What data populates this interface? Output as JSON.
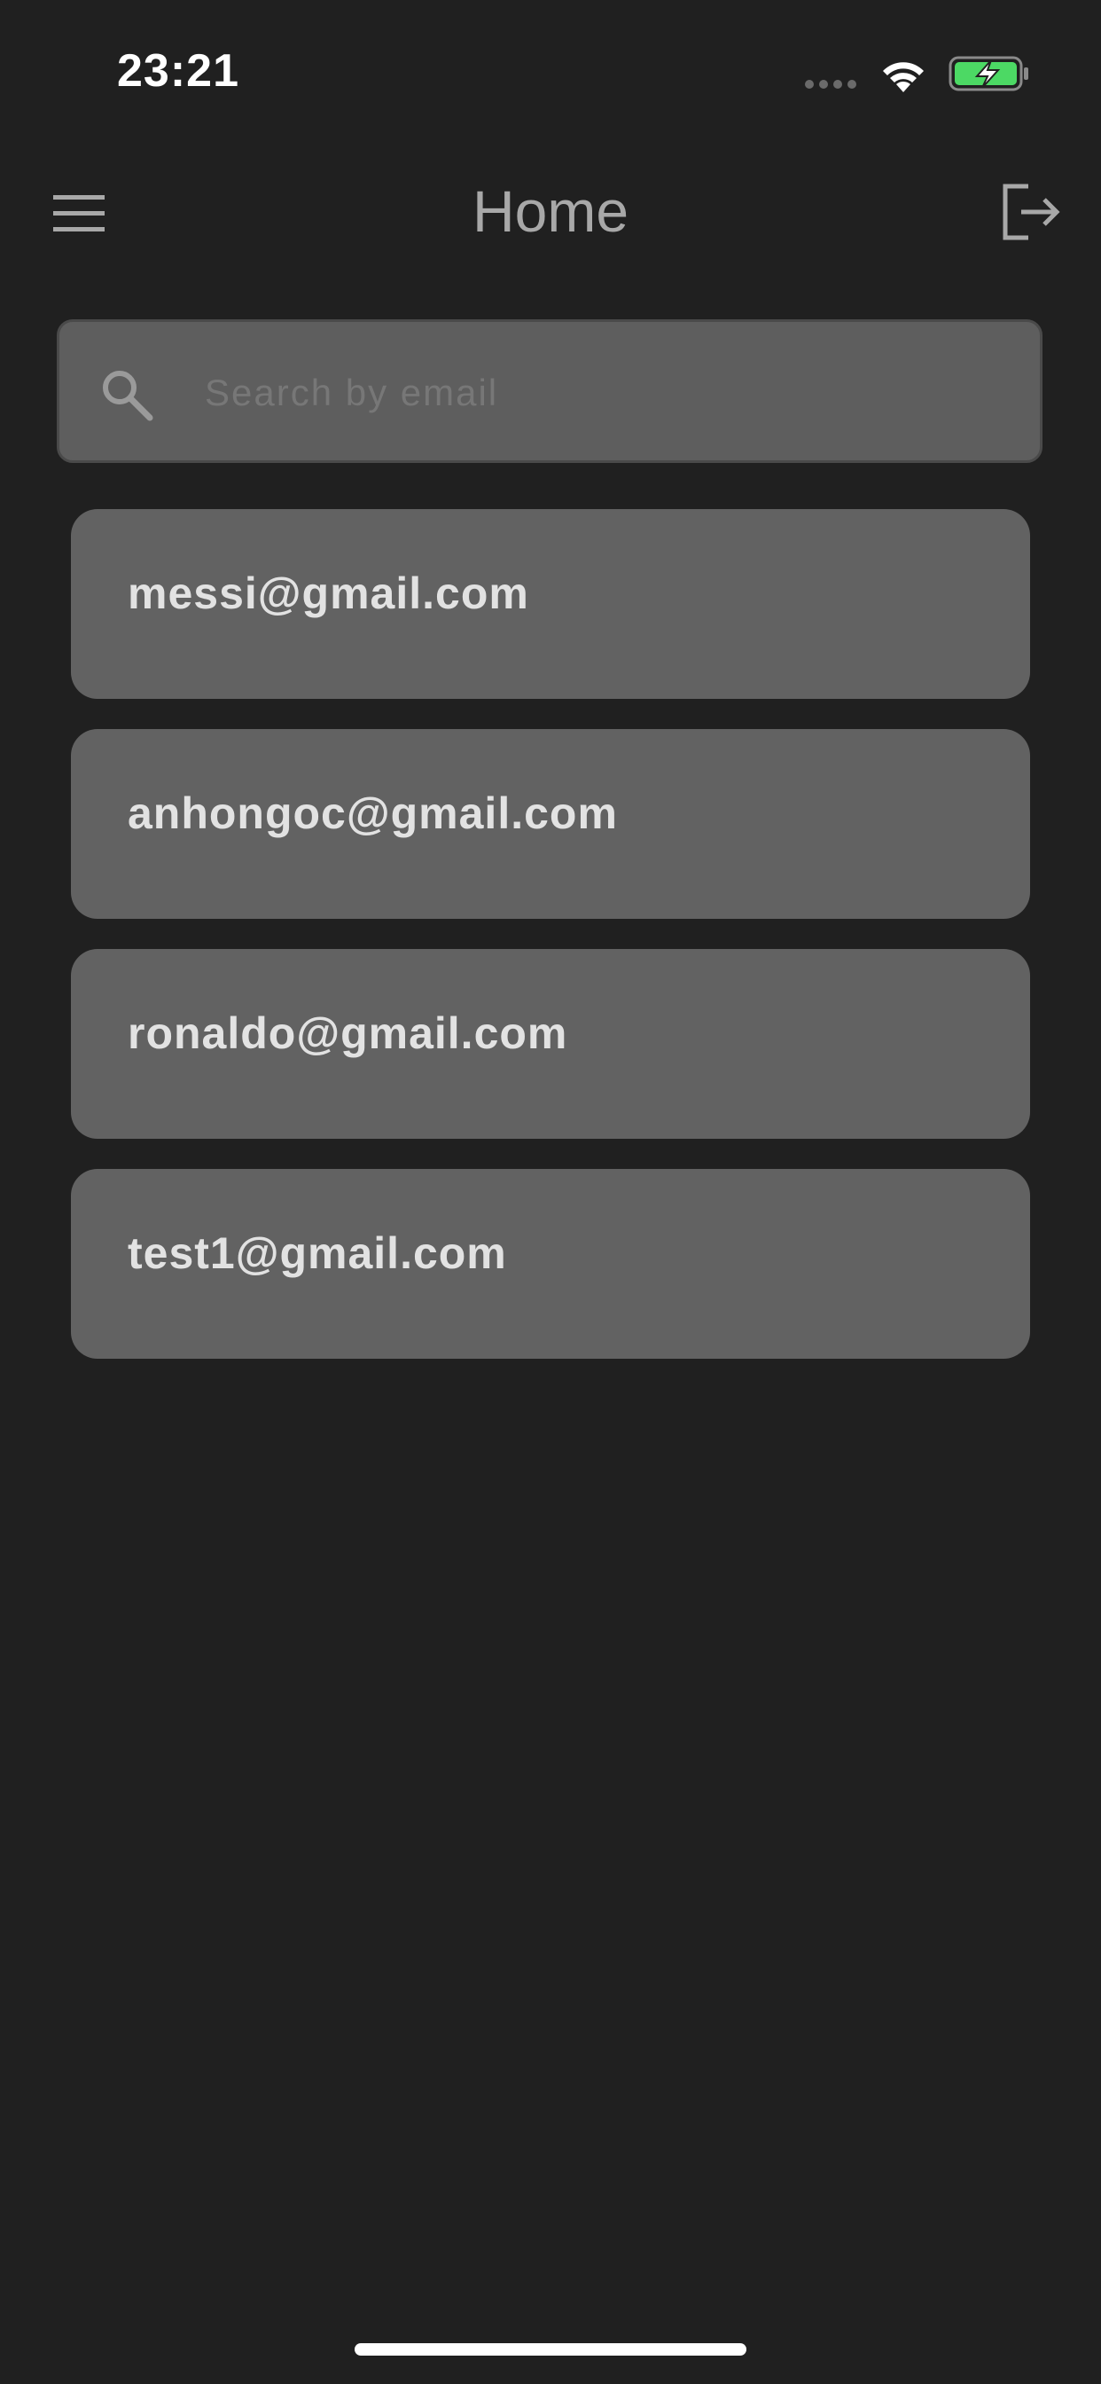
{
  "status_bar": {
    "time": "23:21",
    "icons": [
      "signal-dots-icon",
      "wifi-icon",
      "battery-charging-icon"
    ],
    "battery_color": "#4cd964"
  },
  "header": {
    "title": "Home",
    "left_icon": "menu-icon",
    "right_icon": "logout-icon"
  },
  "search": {
    "placeholder": "Search by email",
    "value": "",
    "icon": "search-icon"
  },
  "emails": [
    {
      "email": "messi@gmail.com"
    },
    {
      "email": "anhongoc@gmail.com"
    },
    {
      "email": "ronaldo@gmail.com"
    },
    {
      "email": "test1@gmail.com"
    }
  ],
  "colors": {
    "background": "#202020",
    "card": "#626262",
    "search_field": "#5e5e5e",
    "title_text": "#a8a8a8",
    "card_text": "#e2e2e2"
  }
}
